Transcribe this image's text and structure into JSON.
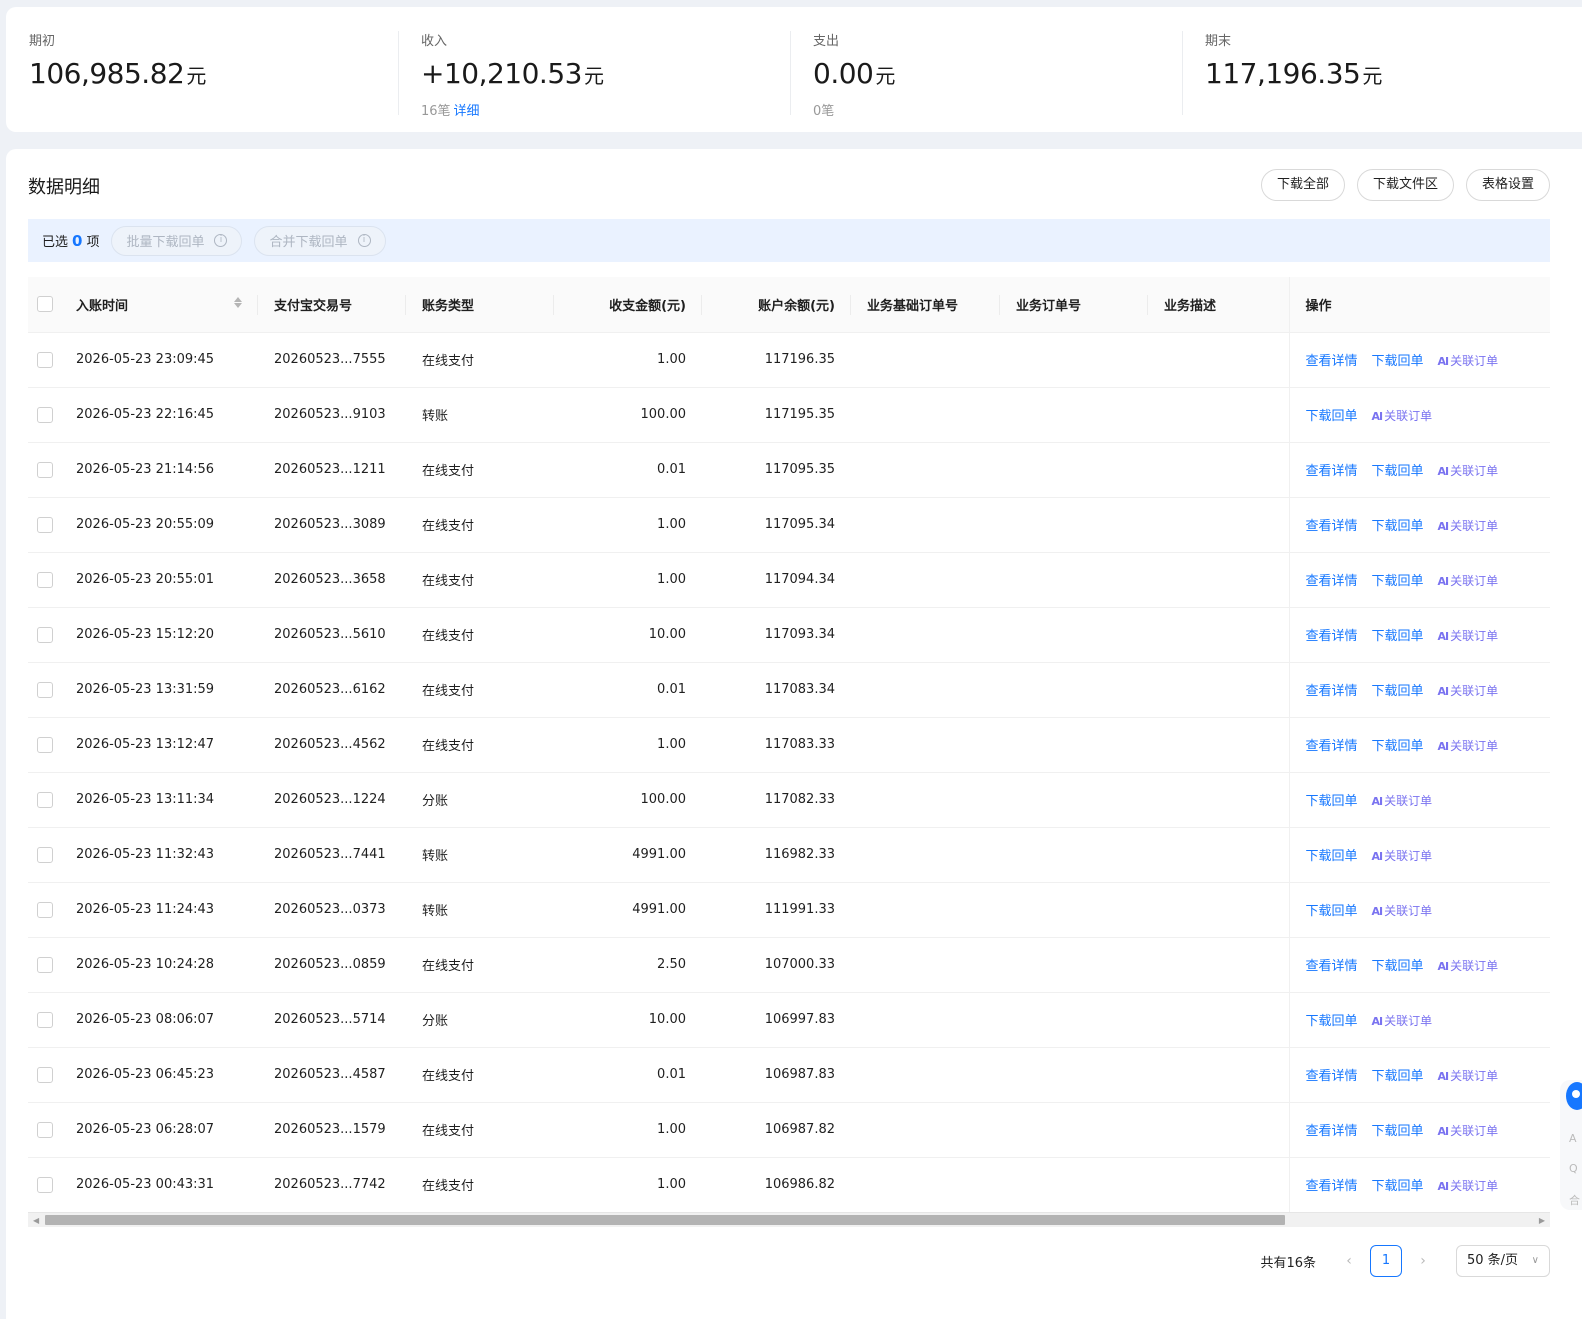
{
  "summary": [
    {
      "label": "期初",
      "amount": "106,985.82",
      "unit": "元",
      "sub": "",
      "sub_link": ""
    },
    {
      "label": "收入",
      "amount": "+10,210.53",
      "unit": "元",
      "sub": "16笔",
      "sub_link": "详细"
    },
    {
      "label": "支出",
      "amount": "0.00",
      "unit": "元",
      "sub": "0笔",
      "sub_link": ""
    },
    {
      "label": "期末",
      "amount": "117,196.35",
      "unit": "元",
      "sub": "",
      "sub_link": ""
    }
  ],
  "detail": {
    "title": "数据明细",
    "actions": [
      "下载全部",
      "下载文件区",
      "表格设置"
    ]
  },
  "selection": {
    "prefix": "已选",
    "count": "0",
    "suffix": "项",
    "batch_download": "批量下载回单",
    "merge_download": "合并下载回单",
    "info_glyph": "i"
  },
  "columns": {
    "time": "入账时间",
    "trade_no": "支付宝交易号",
    "type": "账务类型",
    "amount": "收支金额(元)",
    "balance": "账户余额(元)",
    "base_order": "业务基础订单号",
    "order": "业务订单号",
    "desc": "业务描述",
    "op": "操作"
  },
  "op_labels": {
    "view": "查看详情",
    "download": "下载回单",
    "link": "关联订单",
    "ai_glyph": "AI"
  },
  "rows": [
    {
      "time": "2026-05-23 23:09:45",
      "trade_no": "20260523...7555",
      "type": "在线支付",
      "amount": "1.00",
      "balance": "117196.35",
      "view": true
    },
    {
      "time": "2026-05-23 22:16:45",
      "trade_no": "20260523...9103",
      "type": "转账",
      "amount": "100.00",
      "balance": "117195.35",
      "view": false
    },
    {
      "time": "2026-05-23 21:14:56",
      "trade_no": "20260523...1211",
      "type": "在线支付",
      "amount": "0.01",
      "balance": "117095.35",
      "view": true
    },
    {
      "time": "2026-05-23 20:55:09",
      "trade_no": "20260523...3089",
      "type": "在线支付",
      "amount": "1.00",
      "balance": "117095.34",
      "view": true
    },
    {
      "time": "2026-05-23 20:55:01",
      "trade_no": "20260523...3658",
      "type": "在线支付",
      "amount": "1.00",
      "balance": "117094.34",
      "view": true
    },
    {
      "time": "2026-05-23 15:12:20",
      "trade_no": "20260523...5610",
      "type": "在线支付",
      "amount": "10.00",
      "balance": "117093.34",
      "view": true
    },
    {
      "time": "2026-05-23 13:31:59",
      "trade_no": "20260523...6162",
      "type": "在线支付",
      "amount": "0.01",
      "balance": "117083.34",
      "view": true
    },
    {
      "time": "2026-05-23 13:12:47",
      "trade_no": "20260523...4562",
      "type": "在线支付",
      "amount": "1.00",
      "balance": "117083.33",
      "view": true
    },
    {
      "time": "2026-05-23 13:11:34",
      "trade_no": "20260523...1224",
      "type": "分账",
      "amount": "100.00",
      "balance": "117082.33",
      "view": false
    },
    {
      "time": "2026-05-23 11:32:43",
      "trade_no": "20260523...7441",
      "type": "转账",
      "amount": "4991.00",
      "balance": "116982.33",
      "view": false
    },
    {
      "time": "2026-05-23 11:24:43",
      "trade_no": "20260523...0373",
      "type": "转账",
      "amount": "4991.00",
      "balance": "111991.33",
      "view": false
    },
    {
      "time": "2026-05-23 10:24:28",
      "trade_no": "20260523...0859",
      "type": "在线支付",
      "amount": "2.50",
      "balance": "107000.33",
      "view": true
    },
    {
      "time": "2026-05-23 08:06:07",
      "trade_no": "20260523...5714",
      "type": "分账",
      "amount": "10.00",
      "balance": "106997.83",
      "view": false
    },
    {
      "time": "2026-05-23 06:45:23",
      "trade_no": "20260523...4587",
      "type": "在线支付",
      "amount": "0.01",
      "balance": "106987.83",
      "view": true
    },
    {
      "time": "2026-05-23 06:28:07",
      "trade_no": "20260523...1579",
      "type": "在线支付",
      "amount": "1.00",
      "balance": "106987.82",
      "view": true
    },
    {
      "time": "2026-05-23 00:43:31",
      "trade_no": "20260523...7742",
      "type": "在线支付",
      "amount": "1.00",
      "balance": "106986.82",
      "view": true
    }
  ],
  "pagination": {
    "total": "共有16条",
    "prev": "‹",
    "next": "›",
    "current": "1",
    "page_size": "50 条/页",
    "size_chevron": "∨"
  },
  "scrollbar": {
    "left_arrow": "◀",
    "right_arrow": "▶"
  },
  "float_assist": {
    "items": [
      "A",
      "Q",
      "合"
    ]
  }
}
